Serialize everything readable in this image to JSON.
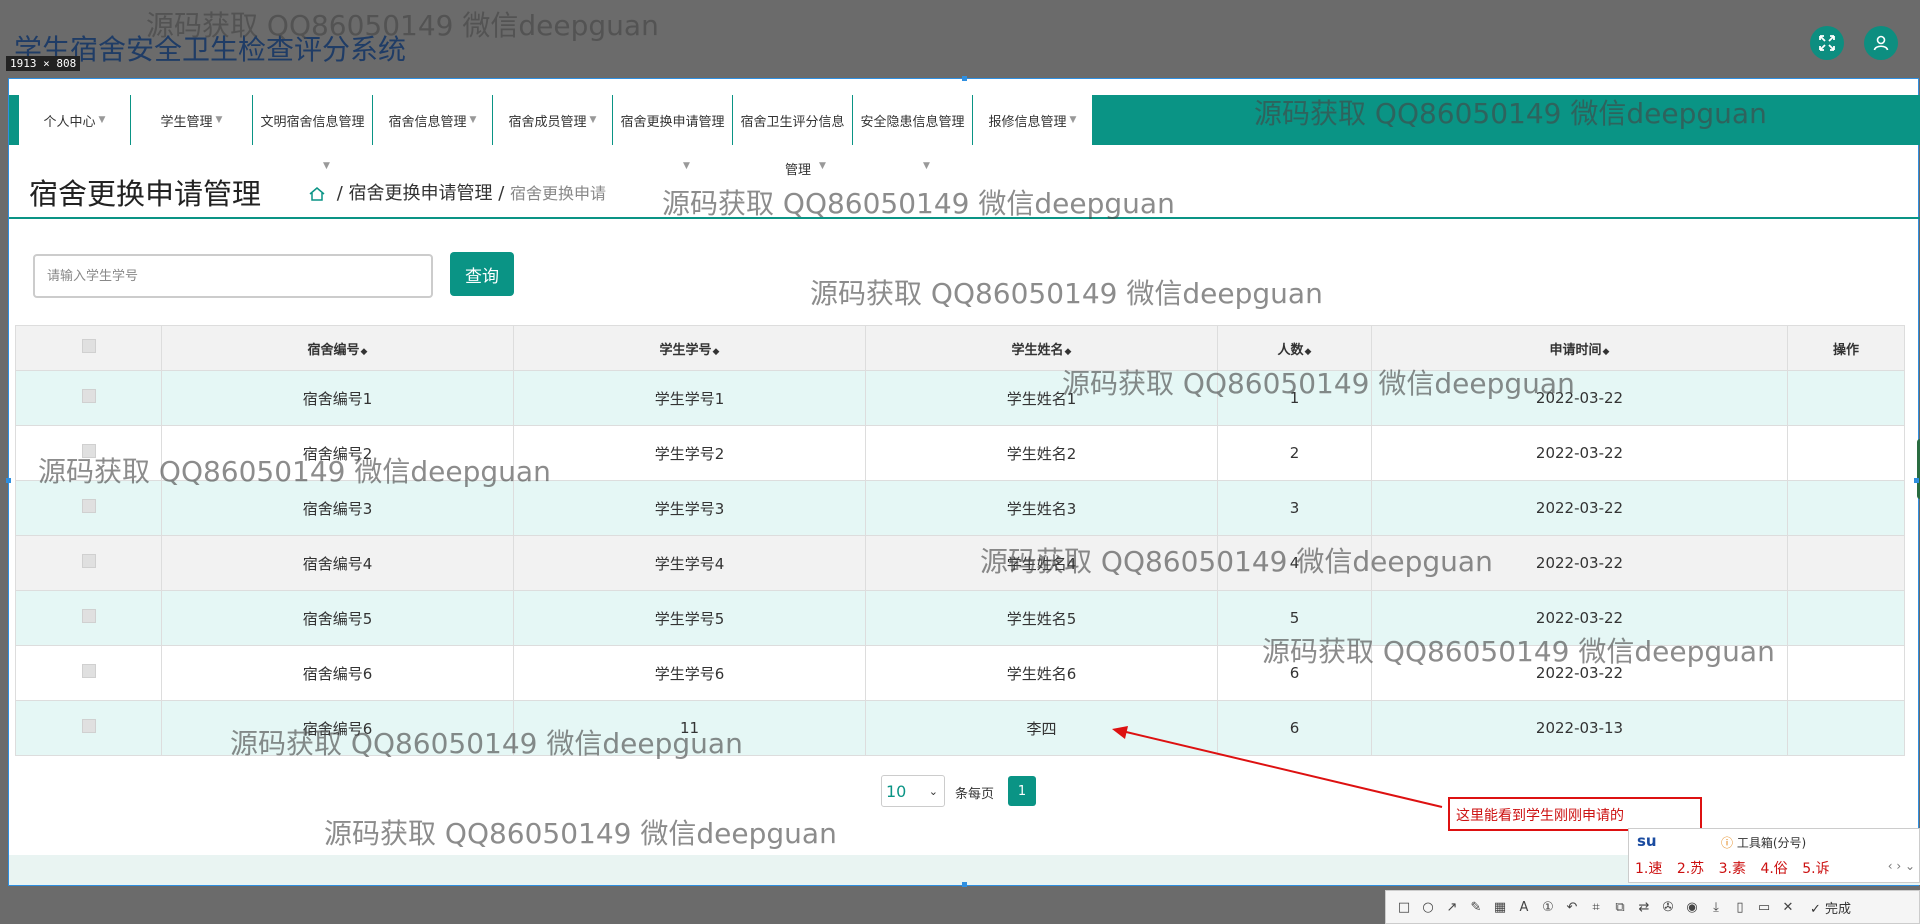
{
  "app": {
    "title": "学生宿舍安全卫生检查评分系统",
    "capture_size_label": "1913 × 808"
  },
  "nav": {
    "items": [
      {
        "label": "个人中心"
      },
      {
        "label": "学生管理"
      },
      {
        "label": "文明宿舍信息管理"
      },
      {
        "label": "宿舍信息管理"
      },
      {
        "label": "宿舍成员管理"
      },
      {
        "label": "宿舍更换申请管理"
      },
      {
        "label": "宿舍卫生评分信息"
      },
      {
        "label": "安全隐患信息管理"
      },
      {
        "label": "报修信息管理"
      }
    ],
    "overflow_label": "管理"
  },
  "page": {
    "heading": "宿舍更换申请管理",
    "breadcrumb_parent": "宿舍更换申请管理",
    "breadcrumb_current": "宿舍更换申请"
  },
  "search": {
    "placeholder": "请输入学生学号",
    "button_label": "查询"
  },
  "table": {
    "columns": [
      "宿舍编号",
      "学生学号",
      "学生姓名",
      "人数",
      "申请时间",
      "操作"
    ],
    "rows": [
      [
        "宿舍编号1",
        "学生学号1",
        "学生姓名1",
        "1",
        "2022-03-22"
      ],
      [
        "宿舍编号2",
        "学生学号2",
        "学生姓名2",
        "2",
        "2022-03-22"
      ],
      [
        "宿舍编号3",
        "学生学号3",
        "学生姓名3",
        "3",
        "2022-03-22"
      ],
      [
        "宿舍编号4",
        "学生学号4",
        "学生姓名4",
        "4",
        "2022-03-22"
      ],
      [
        "宿舍编号5",
        "学生学号5",
        "学生姓名5",
        "5",
        "2022-03-22"
      ],
      [
        "宿舍编号6",
        "学生学号6",
        "学生姓名6",
        "6",
        "2022-03-22"
      ],
      [
        "宿舍编号6",
        "11",
        "李四",
        "6",
        "2022-03-13"
      ]
    ]
  },
  "pagination": {
    "page_size": "10",
    "per_page_label": "条每页",
    "current_page": "1"
  },
  "annotation": {
    "text": "这里能看到学生刚刚申请的"
  },
  "ime": {
    "input": "su",
    "toolbox_label": "工具箱(分号)",
    "candidates": [
      "1.速",
      "2.苏",
      "3.素",
      "4.俗",
      "5.诉"
    ]
  },
  "capture_toolbar": {
    "done_label": "完成"
  },
  "watermark": {
    "text": "源码获取 QQ86050149 微信deepguan"
  },
  "colors": {
    "primary": "#0a9485",
    "row_alt": "#e5f7f5",
    "annotation": "#d11111"
  }
}
